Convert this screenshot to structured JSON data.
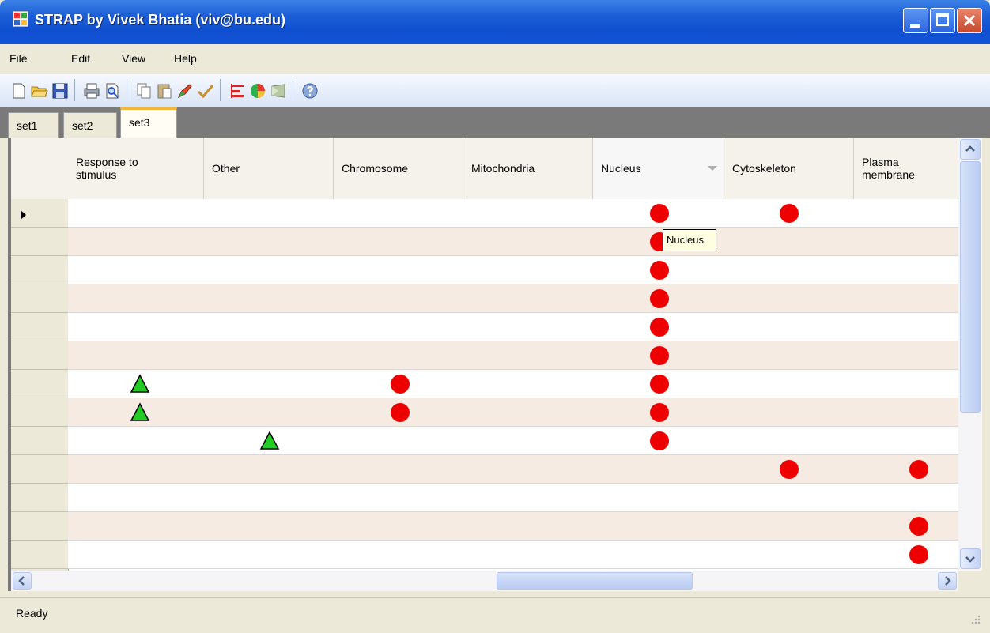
{
  "window": {
    "title": "STRAP by Vivek Bhatia (viv@bu.edu)"
  },
  "menu": [
    "File",
    "Edit",
    "View",
    "Help"
  ],
  "toolbar": {
    "icons": [
      "new-file-icon",
      "open-folder-icon",
      "save-icon",
      "print-icon",
      "print-preview-icon",
      "copy-icon",
      "paste-icon",
      "pen-icon",
      "check-icon",
      "bar-chart-icon",
      "pie-chart-icon",
      "venn-icon",
      "help-icon"
    ]
  },
  "tabs": [
    {
      "label": "set1",
      "active": false
    },
    {
      "label": "set2",
      "active": false
    },
    {
      "label": "set3",
      "active": true
    }
  ],
  "grid": {
    "columns": [
      "Response to stimulus",
      "Other",
      "Chromosome",
      "Mitochondria",
      "Nucleus",
      "Cytoskeleton",
      "Plasma membrane"
    ],
    "sorted_column": "Nucleus",
    "current_row": 0,
    "rows": [
      {
        "marks": [
          null,
          null,
          null,
          null,
          "circle",
          "circle",
          null
        ]
      },
      {
        "marks": [
          null,
          null,
          null,
          null,
          "circle",
          null,
          null
        ]
      },
      {
        "marks": [
          null,
          null,
          null,
          null,
          "circle",
          null,
          null
        ]
      },
      {
        "marks": [
          null,
          null,
          null,
          null,
          "circle",
          null,
          null
        ]
      },
      {
        "marks": [
          null,
          null,
          null,
          null,
          "circle",
          null,
          null
        ]
      },
      {
        "marks": [
          null,
          null,
          null,
          null,
          "circle",
          null,
          null
        ]
      },
      {
        "marks": [
          "triangle",
          null,
          "circle",
          null,
          "circle",
          null,
          null
        ]
      },
      {
        "marks": [
          "triangle",
          null,
          "circle",
          null,
          "circle",
          null,
          null
        ]
      },
      {
        "marks": [
          null,
          "triangle",
          null,
          null,
          "circle",
          null,
          null
        ]
      },
      {
        "marks": [
          null,
          null,
          null,
          null,
          null,
          "circle",
          "circle"
        ]
      },
      {
        "marks": [
          null,
          null,
          null,
          null,
          null,
          null,
          null
        ]
      },
      {
        "marks": [
          null,
          null,
          null,
          null,
          null,
          null,
          "circle"
        ]
      },
      {
        "marks": [
          null,
          null,
          null,
          null,
          null,
          null,
          "circle"
        ]
      }
    ]
  },
  "tooltip": {
    "text": "Nucleus"
  },
  "colors": {
    "circle": "#ee0000",
    "triangle": "#22cc22",
    "odd_row": "#f6ebe3"
  },
  "status": {
    "text": "Ready"
  }
}
